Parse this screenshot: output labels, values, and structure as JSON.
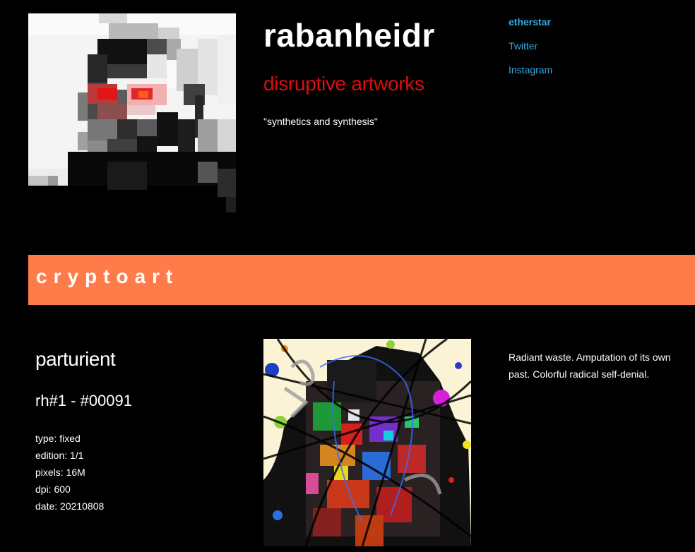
{
  "header": {
    "title": "rabanheidr",
    "subtitle": "disruptive artworks",
    "tagline": "\"synthetics and synthesis\"",
    "subtitle_color": "#e00d0d"
  },
  "nav": {
    "links": [
      {
        "label": "etherstar",
        "bold": true
      },
      {
        "label": "Twitter",
        "bold": false
      },
      {
        "label": "Instagram",
        "bold": false
      }
    ],
    "link_color": "#35a8e0"
  },
  "section": {
    "title": "cryptoart",
    "color": "#ff7b4a"
  },
  "artwork": {
    "title": "parturient",
    "id": "rh#1 - #00091",
    "meta": [
      "type: fixed",
      "edition: 1/1",
      "pixels: 16M",
      "dpi: 600",
      "date: 20210808"
    ],
    "description": "Radiant waste. Amputation of its own past. Colorful radical self-denial."
  }
}
